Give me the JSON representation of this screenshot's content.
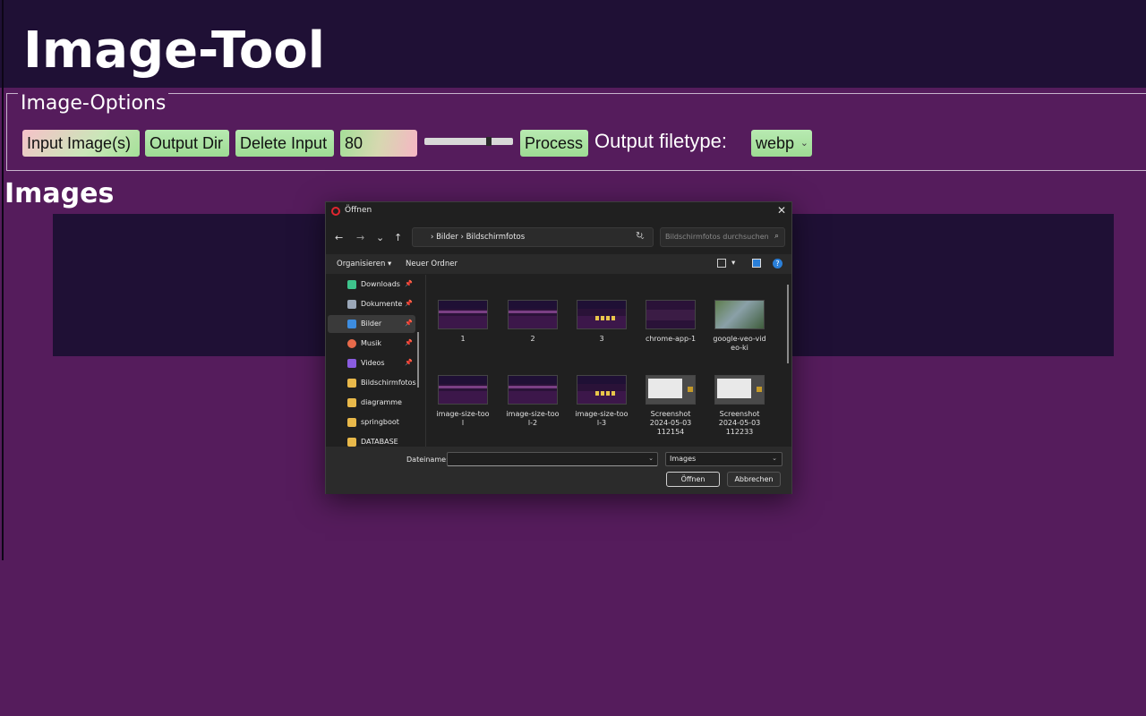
{
  "app": {
    "title": "Image-Tool",
    "options_legend": "Image-Options",
    "buttons": {
      "input_images": "Input Image(s)",
      "output_dir": "Output Dir",
      "delete_input": "Delete Input",
      "process": "Process"
    },
    "quality_value": "80",
    "slider_level": 0.74,
    "output_filetype_label": "Output filetype:",
    "output_filetype_value": "webp",
    "images_heading": "Images"
  },
  "dialog": {
    "title": "Öffnen",
    "close": "✕",
    "nav": {
      "back": "←",
      "forward": "→",
      "recent": "⌄",
      "up": "↑"
    },
    "breadcrumb": "›  Bilder  ›  Bildschirmfotos",
    "search_placeholder": "Bildschirmfotos durchsuchen",
    "toolbar": {
      "organize": "Organisieren ▾",
      "new_folder": "Neuer Ordner",
      "help": "?"
    },
    "sidebar": [
      {
        "label": "Downloads",
        "icon": "download-icon",
        "color": "#3ec48c",
        "pinned": true
      },
      {
        "label": "Dokumente",
        "icon": "document-icon",
        "color": "#9aa7b8",
        "pinned": true
      },
      {
        "label": "Bilder",
        "icon": "pictures-icon",
        "color": "#3d8de0",
        "pinned": true
      },
      {
        "label": "Musik",
        "icon": "music-icon",
        "color": "#e86a4a",
        "pinned": true
      },
      {
        "label": "Videos",
        "icon": "video-icon",
        "color": "#8a5ce0",
        "pinned": true
      },
      {
        "label": "Bildschirmfotos",
        "icon": "folder-icon",
        "color": "#e8b84a",
        "pinned": false
      },
      {
        "label": "diagramme",
        "icon": "folder-icon",
        "color": "#e8b84a",
        "pinned": false
      },
      {
        "label": "springboot",
        "icon": "folder-icon",
        "color": "#e8b84a",
        "pinned": false
      },
      {
        "label": "DATABASE",
        "icon": "folder-icon",
        "color": "#e8b84a",
        "pinned": false
      }
    ],
    "files": [
      {
        "name": "1",
        "kind": "app"
      },
      {
        "name": "2",
        "kind": "app"
      },
      {
        "name": "3",
        "kind": "app-dots"
      },
      {
        "name": "chrome-app-1",
        "kind": "chrome"
      },
      {
        "name": "google-veo-vid\neo-ki",
        "kind": "veo"
      },
      {
        "name": "image-size-too\nl",
        "kind": "app"
      },
      {
        "name": "image-size-too\nl-2",
        "kind": "app"
      },
      {
        "name": "image-size-too\nl-3",
        "kind": "app-dots"
      },
      {
        "name": "Screenshot\n2024-05-03\n112154",
        "kind": "shot"
      },
      {
        "name": "Screenshot\n2024-05-03\n112233",
        "kind": "shot"
      }
    ],
    "footer": {
      "filename_label": "Dateiname:",
      "filename_value": "",
      "filetype_value": "Images",
      "open": "Öffnen",
      "cancel": "Abbrechen"
    }
  }
}
